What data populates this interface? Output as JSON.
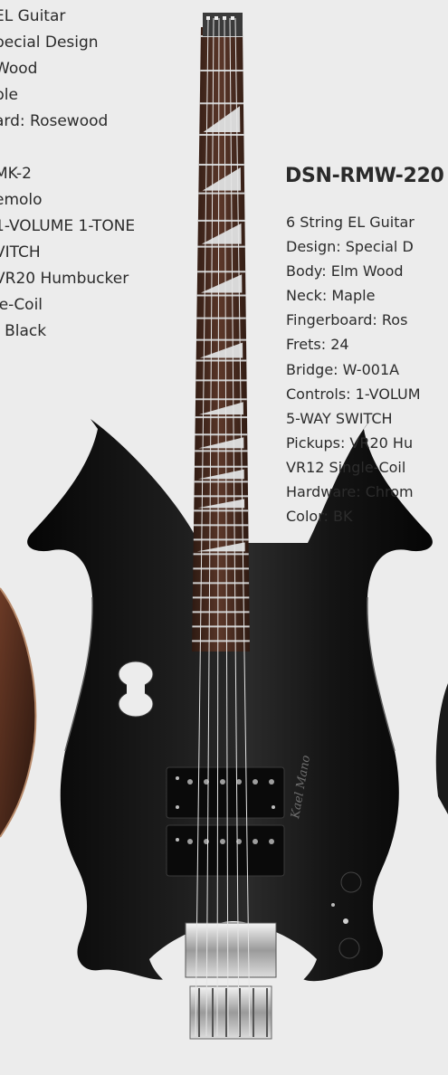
{
  "left_specs": {
    "group1": [
      "EL Guitar",
      "pecial Design",
      "Wood",
      "ple",
      "ard: Rosewood"
    ],
    "group2": [
      "MK-2",
      "emolo",
      "1-VOLUME 1-TONE",
      "VITCH",
      "VR20 Humbucker",
      "le-Coil",
      ": Black"
    ]
  },
  "model": {
    "name": "DSN-RMW-220",
    "specs": [
      "6 String EL Guitar",
      "Design: Special D",
      "Body: Elm Wood",
      "Neck: Maple",
      "Fingerboard: Ros",
      "Frets: 24",
      "Bridge: W-001A",
      "Controls: 1-VOLUM",
      "5-WAY SWITCH",
      "Pickups: VR20 Hu",
      "VR12 Single-Coil",
      "Hardware: Chrom",
      "Color: BK"
    ]
  },
  "body_signature": "Kael Mano",
  "colors": {
    "background": "#ececec",
    "guitar_body": "#0e0e0e",
    "fretboard": "#4a2e22",
    "inlay": "#dcdcdc",
    "text": "#2b2b2b"
  }
}
